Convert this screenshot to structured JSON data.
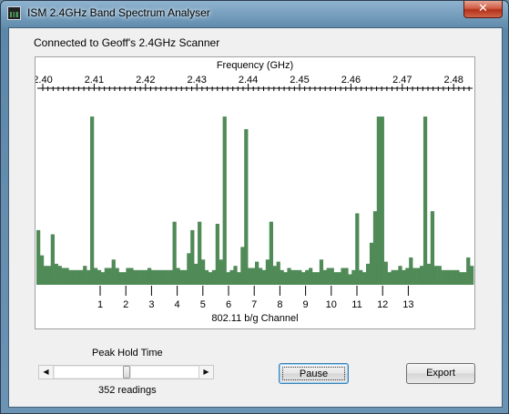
{
  "window": {
    "title": "ISM 2.4GHz Band Spectrum Analyser",
    "close_glyph": "✕"
  },
  "status": {
    "text": "Connected to Geoff's 2.4GHz Scanner"
  },
  "chart_data": {
    "type": "bar",
    "title": "",
    "top_axis_label": "Frequency  (GHz)",
    "top_ticks": [
      "2.40",
      "2.41",
      "2.42",
      "2.43",
      "2.44",
      "2.45",
      "2.46",
      "2.47",
      "2.48"
    ],
    "bottom_axis_label": "802.11 b/g  Channel",
    "bottom_ticks": [
      "1",
      "2",
      "3",
      "4",
      "5",
      "6",
      "7",
      "8",
      "9",
      "10",
      "11",
      "12",
      "13"
    ],
    "x_range_ghz": [
      2.4,
      2.485
    ],
    "bar_color": "#4f8a57",
    "series": [
      {
        "values": [
          26,
          14,
          9,
          9,
          24,
          10,
          9,
          8,
          8,
          7,
          7,
          7,
          7,
          9,
          7,
          80,
          8,
          7,
          6,
          8,
          8,
          12,
          8,
          6,
          6,
          8,
          8,
          7,
          7,
          7,
          7,
          8,
          7,
          7,
          7,
          7,
          7,
          7,
          30,
          8,
          7,
          7,
          15,
          26,
          10,
          30,
          12,
          7,
          6,
          7,
          29,
          12,
          80,
          6,
          7,
          9,
          6,
          18,
          74,
          8,
          8,
          11,
          8,
          7,
          12,
          30,
          9,
          11,
          7,
          6,
          8,
          7,
          7,
          7,
          6,
          7,
          8,
          6,
          6,
          12,
          7,
          8,
          8,
          6,
          6,
          8,
          8,
          5,
          7,
          34,
          7,
          6,
          10,
          20,
          35,
          80,
          80,
          11,
          6,
          7,
          7,
          9,
          7,
          8,
          13,
          8,
          8,
          9,
          80,
          10,
          35,
          9,
          9,
          7,
          7,
          7,
          7,
          7,
          6,
          6,
          13,
          9
        ],
        "ymax": 90
      }
    ]
  },
  "peak_hold": {
    "label": "Peak Hold Time",
    "readout": "352 readings",
    "level": 0.5,
    "left_arrow": "◀",
    "right_arrow": "▶"
  },
  "buttons": {
    "pause": "Pause",
    "export": "Export"
  }
}
